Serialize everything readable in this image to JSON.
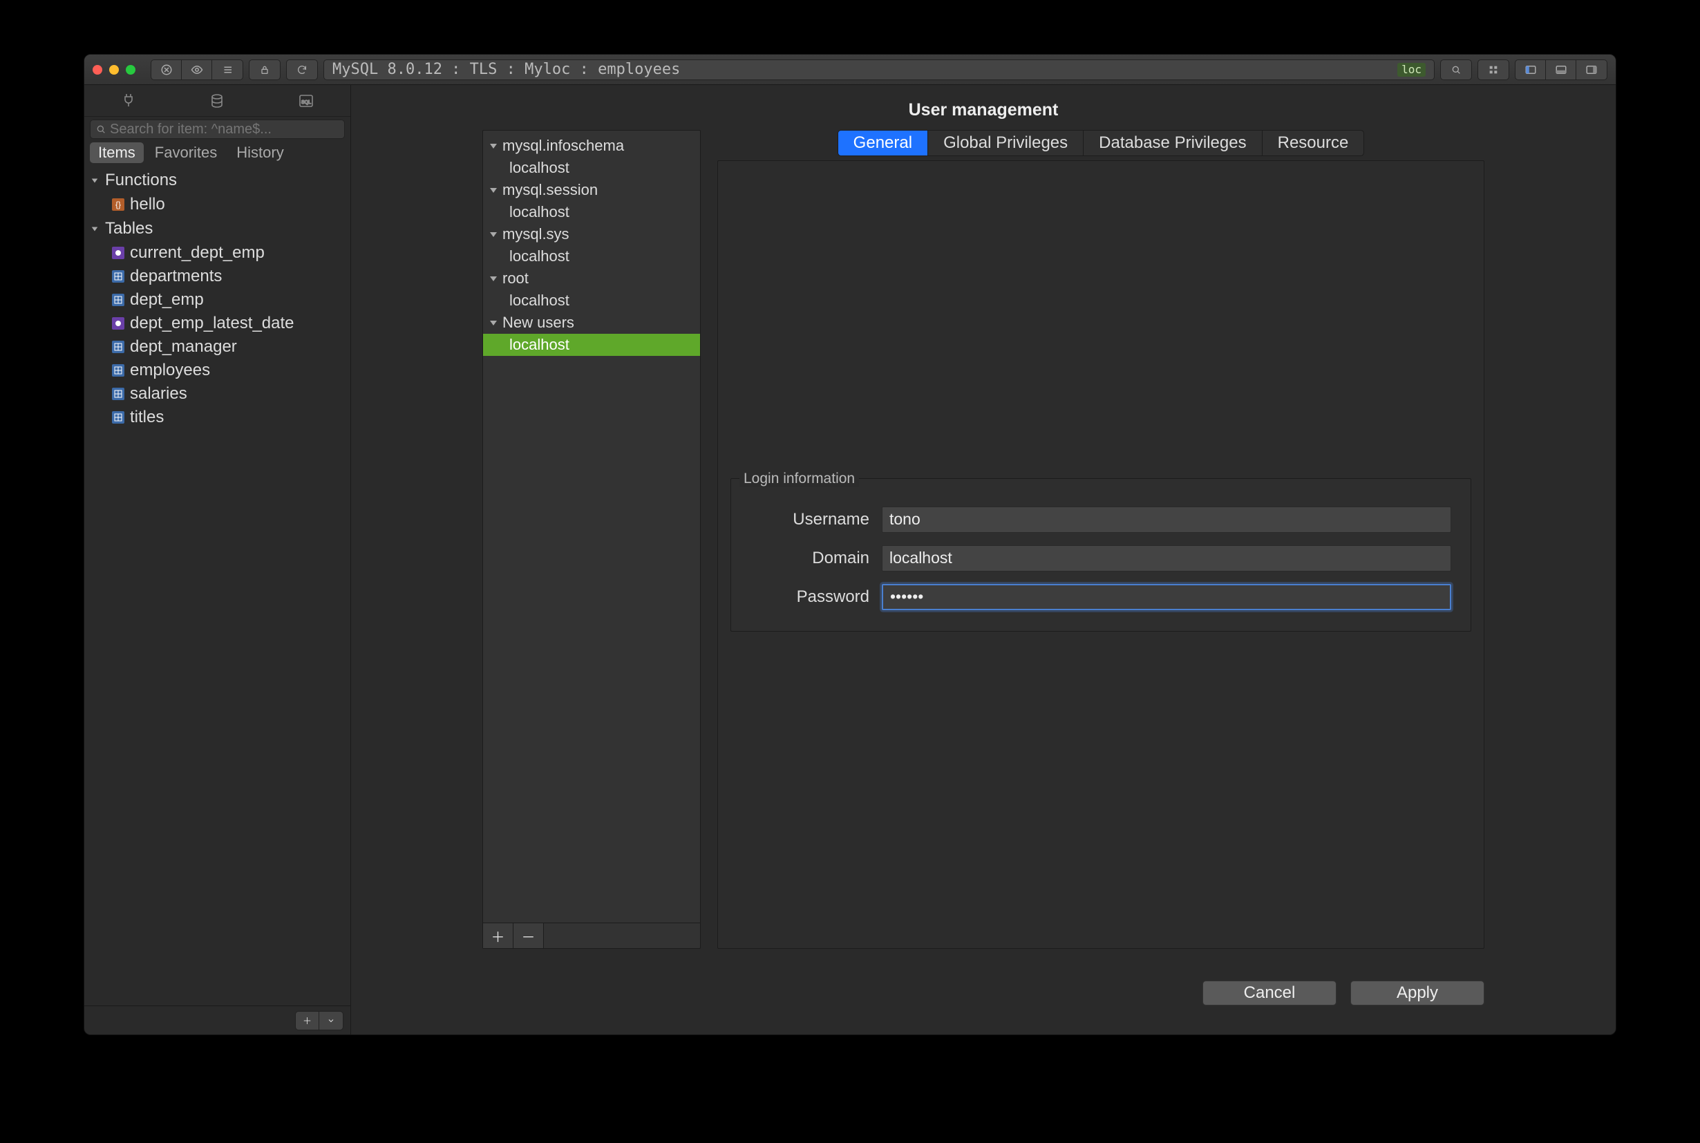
{
  "titlebar": {
    "breadcrumb": "MySQL 8.0.12 : TLS : Myloc : employees",
    "loc_badge": "loc"
  },
  "sidebar": {
    "search_placeholder": "Search for item: ^name$...",
    "tabs": [
      "Items",
      "Favorites",
      "History"
    ],
    "active_tab": 0,
    "groups": [
      {
        "label": "Functions",
        "items": [
          {
            "label": "hello",
            "kind": "func"
          }
        ]
      },
      {
        "label": "Tables",
        "items": [
          {
            "label": "current_dept_emp",
            "kind": "view"
          },
          {
            "label": "departments",
            "kind": "table"
          },
          {
            "label": "dept_emp",
            "kind": "table"
          },
          {
            "label": "dept_emp_latest_date",
            "kind": "view"
          },
          {
            "label": "dept_manager",
            "kind": "table"
          },
          {
            "label": "employees",
            "kind": "table"
          },
          {
            "label": "salaries",
            "kind": "table"
          },
          {
            "label": "titles",
            "kind": "table"
          }
        ]
      }
    ]
  },
  "modal": {
    "title": "User management",
    "tabs": [
      "General",
      "Global Privileges",
      "Database Privileges",
      "Resource"
    ],
    "active_tab": 0,
    "user_tree": [
      {
        "label": "mysql.infoschema",
        "children": [
          "localhost"
        ]
      },
      {
        "label": "mysql.session",
        "children": [
          "localhost"
        ]
      },
      {
        "label": "mysql.sys",
        "children": [
          "localhost"
        ]
      },
      {
        "label": "root",
        "children": [
          "localhost"
        ]
      },
      {
        "label": "New users",
        "children": [
          "localhost"
        ],
        "child_selected": 0
      }
    ],
    "fieldset_legend": "Login information",
    "fields": {
      "username_label": "Username",
      "username_value": "tono",
      "domain_label": "Domain",
      "domain_value": "localhost",
      "password_label": "Password",
      "password_value": "••••••"
    },
    "buttons": {
      "cancel": "Cancel",
      "apply": "Apply"
    }
  }
}
